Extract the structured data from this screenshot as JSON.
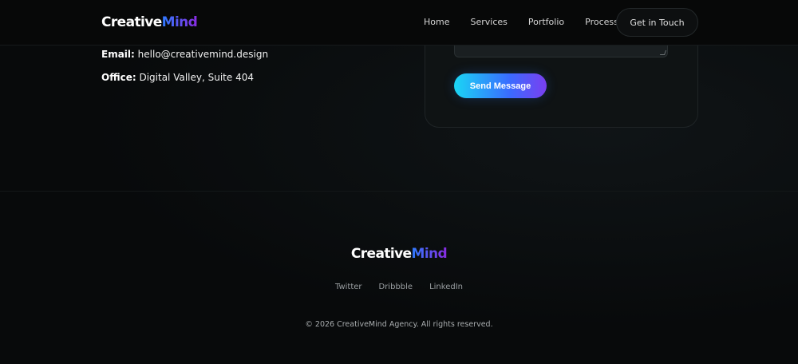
{
  "brand": {
    "name_main": "Creative",
    "name_accent": "Mind"
  },
  "nav": {
    "items": [
      {
        "label": "Home"
      },
      {
        "label": "Services"
      },
      {
        "label": "Portfolio"
      },
      {
        "label": "Process"
      }
    ],
    "cta_label": "Get in Touch"
  },
  "contact": {
    "email_label": "Email:",
    "email_value": "hello@creativemind.design",
    "office_label": "Office:",
    "office_value": "Digital Valley, Suite 404"
  },
  "form": {
    "send_label": "Send Message"
  },
  "footer": {
    "social": [
      {
        "label": "Twitter"
      },
      {
        "label": "Dribbble"
      },
      {
        "label": "LinkedIn"
      }
    ],
    "copyright": "© 2026 CreativeMind Agency. All rights reserved."
  },
  "colors": {
    "background": "#080a0b",
    "accent_start": "#1ad6f4",
    "accent_end": "#7a3ff0",
    "logo_accent": "#2f7bff"
  }
}
